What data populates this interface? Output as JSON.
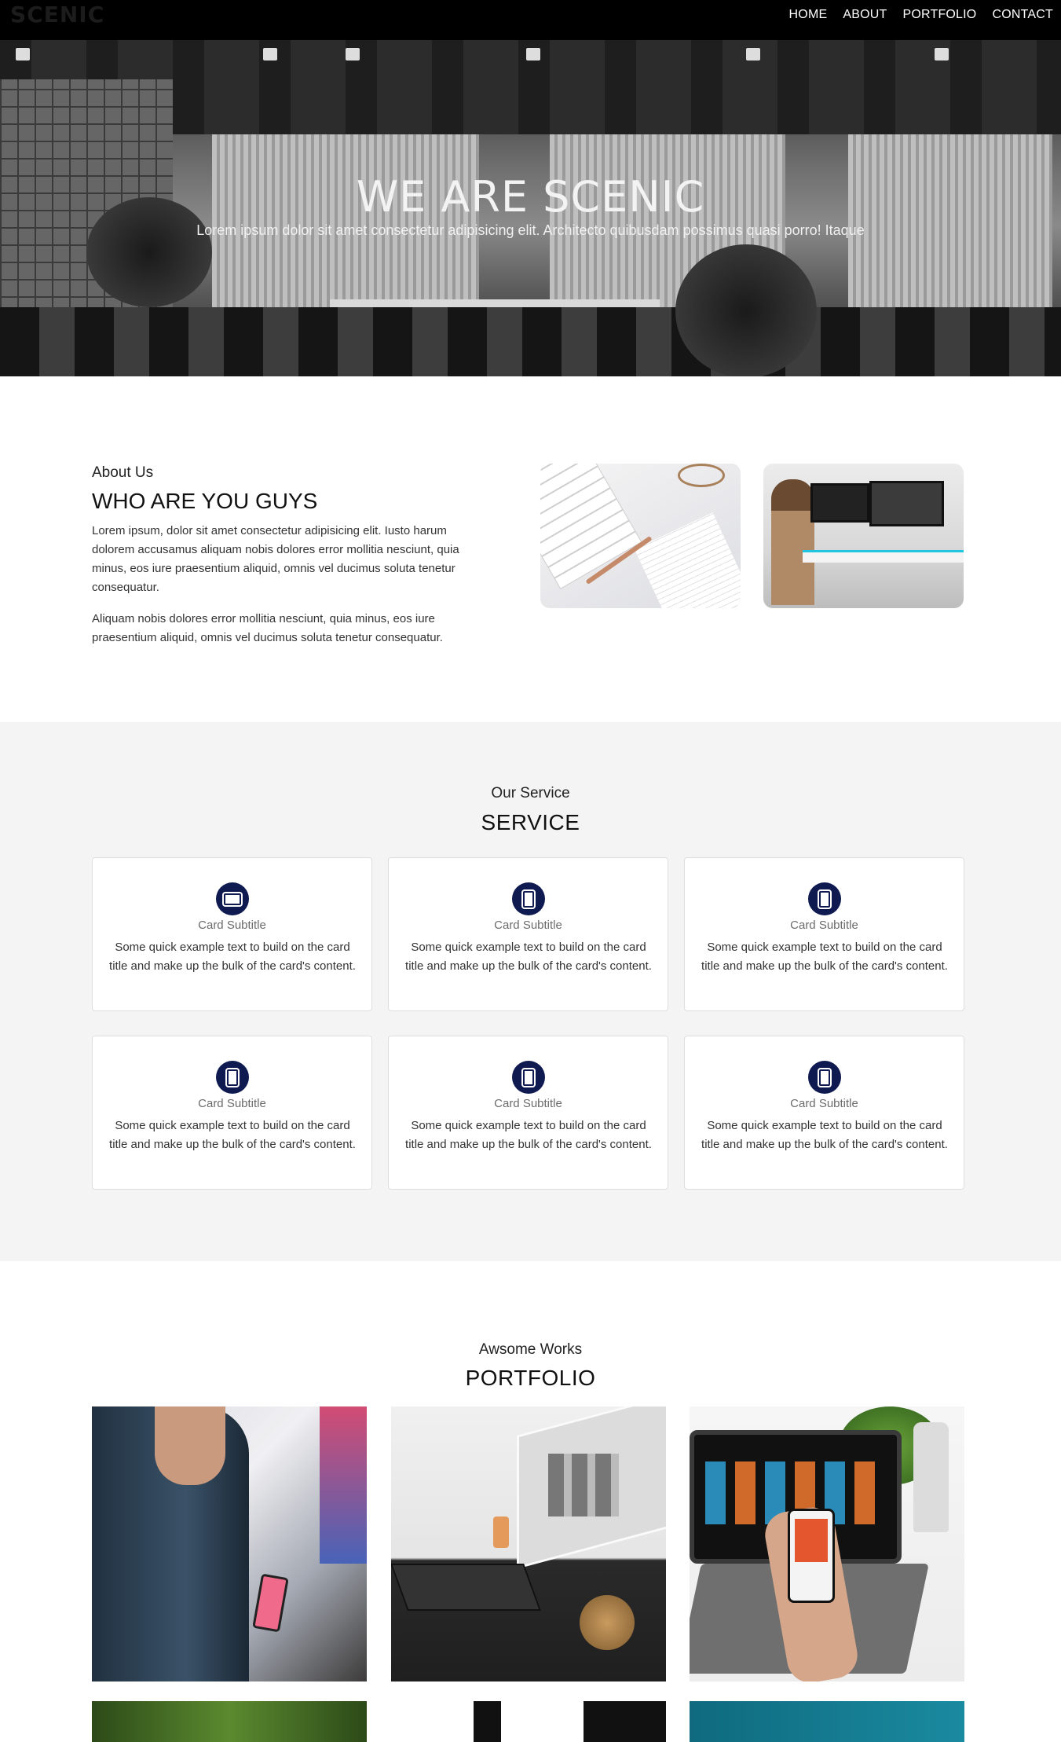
{
  "nav": {
    "logo": "SCENIC",
    "links": [
      "HOME",
      "ABOUT",
      "PORTFOLIO",
      "CONTACT"
    ]
  },
  "hero": {
    "title": "WE ARE SCENIC",
    "subtitle": "Lorem ipsum dolor sit amet consectetur adipisicing elit. Architecto quibusdam possimus quasi porro! Itaque"
  },
  "about": {
    "pre": "About Us",
    "title": "WHO ARE YOU GUYS",
    "p1": "Lorem ipsum, dolor sit amet consectetur adipisicing elit. Iusto harum dolorem accusamus aliquam nobis dolores error mollitia nesciunt, quia minus, eos iure praesentium aliquid, omnis vel ducimus soluta tenetur consequatur.",
    "p2": "Aliquam nobis dolores error mollitia nesciunt, quia minus, eos iure praesentium aliquid, omnis vel ducimus soluta tenetur consequatur."
  },
  "service": {
    "pre": "Our Service",
    "title": "SERVICE",
    "cards": [
      {
        "icon": "tablet-landscape-icon",
        "subtitle": "Card Subtitle",
        "text": "Some quick example text to build on the card title and make up the bulk of the card's content."
      },
      {
        "icon": "mobile-icon",
        "subtitle": "Card Subtitle",
        "text": "Some quick example text to build on the card title and make up the bulk of the card's content."
      },
      {
        "icon": "mobile-icon",
        "subtitle": "Card Subtitle",
        "text": "Some quick example text to build on the card title and make up the bulk of the card's content."
      },
      {
        "icon": "mobile-icon",
        "subtitle": "Card Subtitle",
        "text": "Some quick example text to build on the card title and make up the bulk of the card's content."
      },
      {
        "icon": "mobile-icon",
        "subtitle": "Card Subtitle",
        "text": "Some quick example text to build on the card title and make up the bulk of the card's content."
      },
      {
        "icon": "mobile-icon",
        "subtitle": "Card Subtitle",
        "text": "Some quick example text to build on the card title and make up the bulk of the card's content."
      }
    ]
  },
  "portfolio": {
    "pre": "Awsome Works",
    "title": "PORTFOLIO"
  },
  "colors": {
    "nav_bg": "#000000",
    "service_bg": "#f4f4f4",
    "icon_circle": "#0f1a50"
  }
}
